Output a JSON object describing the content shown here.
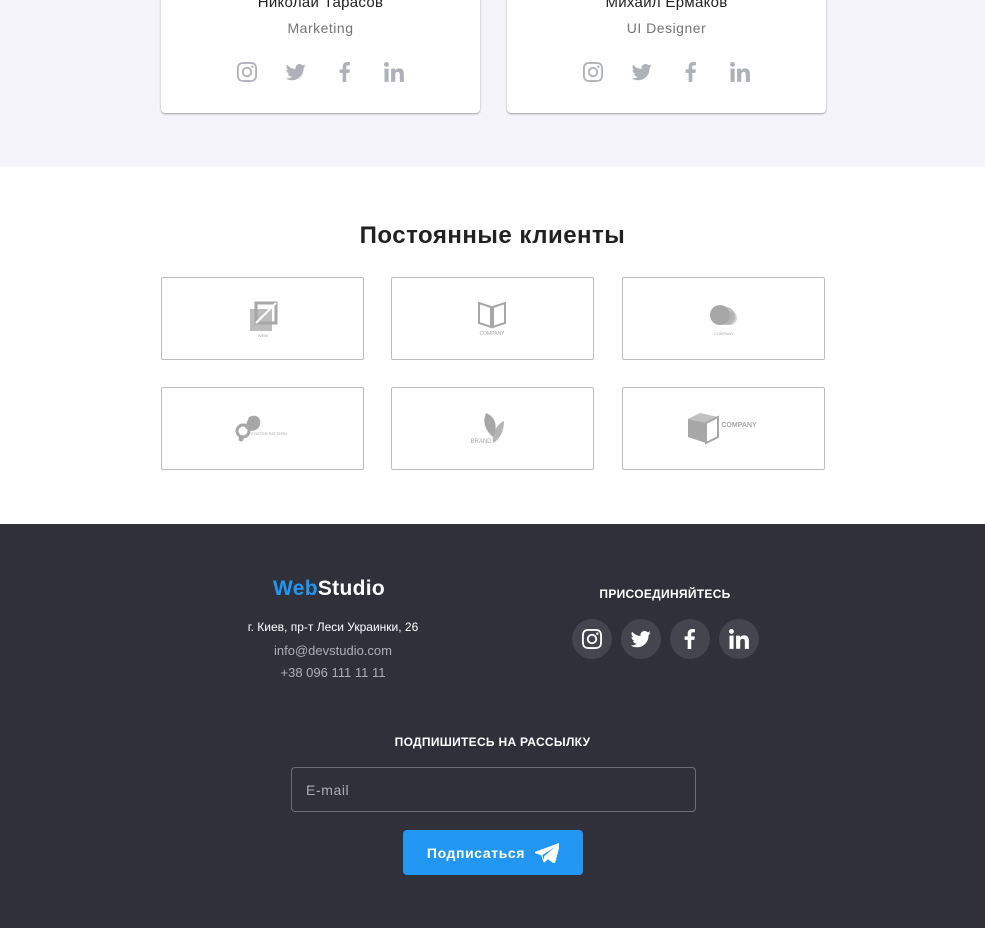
{
  "team": {
    "members": [
      {
        "name": "Николай Тарасов",
        "role": "Marketing",
        "socials": [
          "instagram-icon",
          "twitter-icon",
          "facebook-icon",
          "linkedin-icon"
        ]
      },
      {
        "name": "Михаил Ермаков",
        "role": "UI Designer",
        "socials": [
          "instagram-icon",
          "twitter-icon",
          "facebook-icon",
          "linkedin-icon"
        ]
      }
    ]
  },
  "clients": {
    "title": "Постоянные клиенты",
    "logos": [
      {
        "icon": "squares-logo-icon",
        "caption": "WEBI"
      },
      {
        "icon": "book-logo-icon",
        "caption": "COMPANY"
      },
      {
        "icon": "leaf-circles-logo-icon",
        "caption": "COMPANY"
      },
      {
        "icon": "poster-logo-icon",
        "caption": "POSTER PATTERN"
      },
      {
        "icon": "brand-leaf-logo-icon",
        "caption": "BRAND"
      },
      {
        "icon": "cube-logo-icon",
        "caption": "COMPANY"
      }
    ]
  },
  "footer": {
    "logo_accent": "Web",
    "logo_rest": "Studio",
    "address": "г. Киев, пр-т Леси Украинки, 26",
    "email": "info@devstudio.com",
    "phone": "+38 096 111 11 11",
    "join_title": "ПРИСОЕДИНЯЙТЕСЬ",
    "socials": [
      "instagram-icon",
      "twitter-icon",
      "facebook-icon",
      "linkedin-icon"
    ],
    "subscribe_title": "ПОДПИШИТЕСЬ НА РАССЫЛКУ",
    "email_placeholder": "E-mail",
    "subscribe_button": "Подписаться"
  },
  "colors": {
    "accent": "#2196f3",
    "footer_bg": "#2f303a",
    "team_bg": "#f5f4fa",
    "icon_gray": "#afb1b8"
  }
}
